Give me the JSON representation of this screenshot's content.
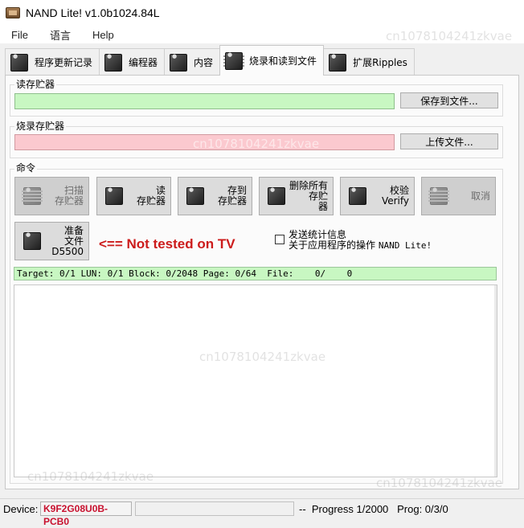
{
  "window": {
    "title": "NAND Lite! v1.0b1024.84L"
  },
  "menu": [
    "File",
    "语言",
    "Help"
  ],
  "tabs": [
    {
      "label": "程序更新记录"
    },
    {
      "label": "编程器"
    },
    {
      "label": "内容"
    },
    {
      "label": "烧录和读到文件",
      "active": true
    },
    {
      "label": "扩展Ripples"
    }
  ],
  "read_section": {
    "label": "读存贮器",
    "save_button": "保存到文件..."
  },
  "write_section": {
    "label": "烧录存贮器",
    "upload_button": "上传文件..."
  },
  "commands": {
    "label": "命令",
    "buttons": [
      {
        "line1": "扫描",
        "line2": "存贮器",
        "disabled": true
      },
      {
        "line1": "读",
        "line2": "存贮器"
      },
      {
        "line1": "存到",
        "line2": "存贮器"
      },
      {
        "line1": "删除所有存贮",
        "line2": "器"
      },
      {
        "line1": "校验Verify",
        "line2": ""
      },
      {
        "line1": "取消",
        "line2": "",
        "disabled": true
      }
    ],
    "ready_button": {
      "line1": "准备",
      "line2": "文件",
      "line3": "D5500"
    },
    "warning": "<== Not tested on TV",
    "send_stats": {
      "line1": "发送统计信息",
      "line2_prefix": "关于应用程序的操作",
      "line2_app": "NAND Lite!",
      "checked": false
    }
  },
  "info_line": "Target: 0/1 LUN: 0/1 Block: 0/2048 Page: 0/64  File:    0/    0",
  "status": {
    "device_label": "Device:",
    "device_value": "K9F2G08U0B-PCB0",
    "right_text": "--  Progress 1/2000   Prog: 0/3/0"
  },
  "watermarks": [
    "cn1078104241zkvae",
    "cn1078104241zkvae",
    "cn1078104241zkvae",
    "cn1078104241zkvae",
    "cn1078104241zkvae"
  ],
  "colors": {
    "read_bar": "#c8f7c2",
    "write_bar": "#fbc9cf",
    "warning": "#cc1b1b",
    "device": "#c8102e"
  }
}
